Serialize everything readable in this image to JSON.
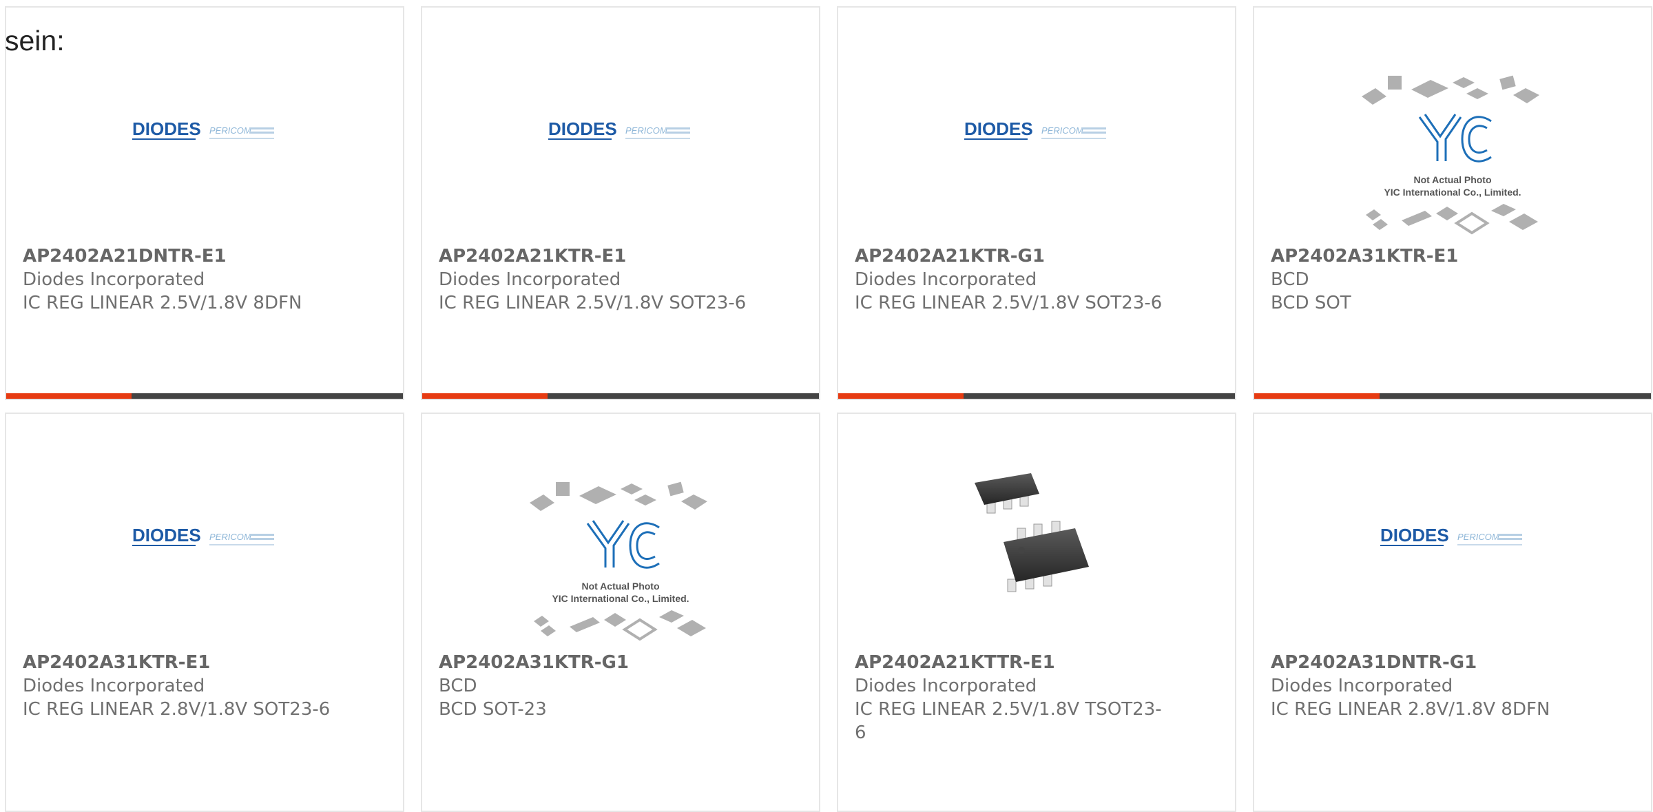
{
  "intro_text": "sein:",
  "diodes_logo": {
    "brand": "DIODES",
    "sub": "PERICOM"
  },
  "yic_logo": {
    "mark": "YIC",
    "line1": "Not Actual Photo",
    "line2": "YIC International Co., Limited."
  },
  "colors": {
    "accent": "#e63b12",
    "dark_bar": "#444444",
    "diodes_blue": "#1d5aa6"
  },
  "products": [
    {
      "part": "AP2402A21DNTR-E1",
      "manufacturer": "Diodes Incorporated",
      "desc": "IC REG LINEAR 2.5V/1.8V 8DFN",
      "image": "diodes-logo"
    },
    {
      "part": "AP2402A21KTR-E1",
      "manufacturer": "Diodes Incorporated",
      "desc": "IC REG LINEAR 2.5V/1.8V SOT23-6",
      "image": "diodes-logo"
    },
    {
      "part": "AP2402A21KTR-G1",
      "manufacturer": "Diodes Incorporated",
      "desc": "IC REG LINEAR 2.5V/1.8V SOT23-6",
      "image": "diodes-logo"
    },
    {
      "part": "AP2402A31KTR-E1",
      "manufacturer": "BCD",
      "desc": "BCD SOT",
      "image": "yic-placeholder"
    },
    {
      "part": "AP2402A31KTR-E1",
      "manufacturer": "Diodes Incorporated",
      "desc": "IC REG LINEAR 2.8V/1.8V SOT23-6",
      "image": "diodes-logo"
    },
    {
      "part": "AP2402A31KTR-G1",
      "manufacturer": "BCD",
      "desc": "BCD SOT-23",
      "image": "yic-placeholder"
    },
    {
      "part": "AP2402A21KTTR-E1",
      "manufacturer": "Diodes Incorporated",
      "desc": "IC REG LINEAR 2.5V/1.8V TSOT23-6",
      "image": "sot23-chip-photo"
    },
    {
      "part": "AP2402A31DNTR-G1",
      "manufacturer": "Diodes Incorporated",
      "desc": "IC REG LINEAR 2.8V/1.8V 8DFN",
      "image": "diodes-logo"
    }
  ]
}
